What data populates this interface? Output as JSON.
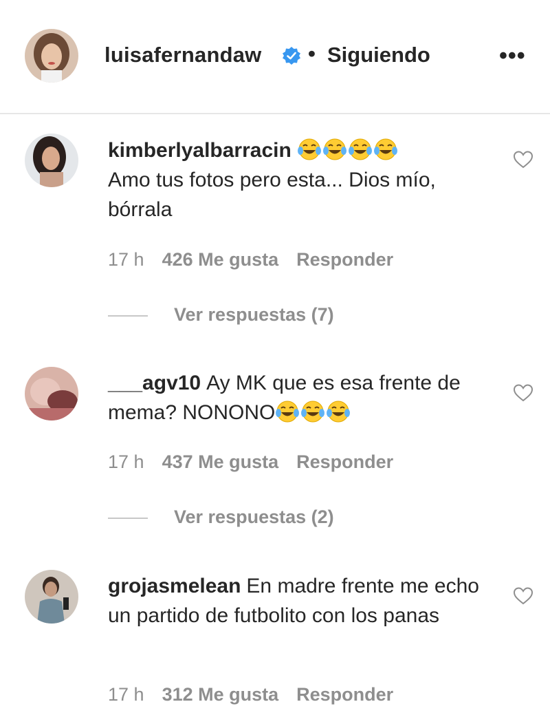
{
  "header": {
    "username": "luisafernandaw",
    "separator": "•",
    "follow_status": "Siguiendo",
    "more_label": "•••"
  },
  "comments": [
    {
      "username": "kimberlyalbarracin",
      "text": "Amo tus fotos pero esta... Dios mío, bórrala",
      "emoji_count": 4,
      "time": "17 h",
      "likes": "426 Me gusta",
      "reply_label": "Responder",
      "view_replies": "Ver respuestas (7)"
    },
    {
      "username": "___agv10",
      "text": "Ay MK que es esa frente de mema? NONONO",
      "emoji_count": 3,
      "time": "17 h",
      "likes": "437 Me gusta",
      "reply_label": "Responder",
      "view_replies": "Ver respuestas (2)"
    },
    {
      "username": "grojasmelean",
      "text": "En madre frente me echo un partido de futbolito con los panas",
      "time": "17 h",
      "likes": "312 Me gusta",
      "reply_label": "Responder"
    }
  ],
  "icons": {
    "verified": "verified-badge-icon",
    "like": "heart-outline-icon",
    "emoji": "tears-of-joy-emoji"
  },
  "colors": {
    "verified_blue": "#3897f0",
    "meta_gray": "#8e8e8e",
    "text": "#262626"
  }
}
